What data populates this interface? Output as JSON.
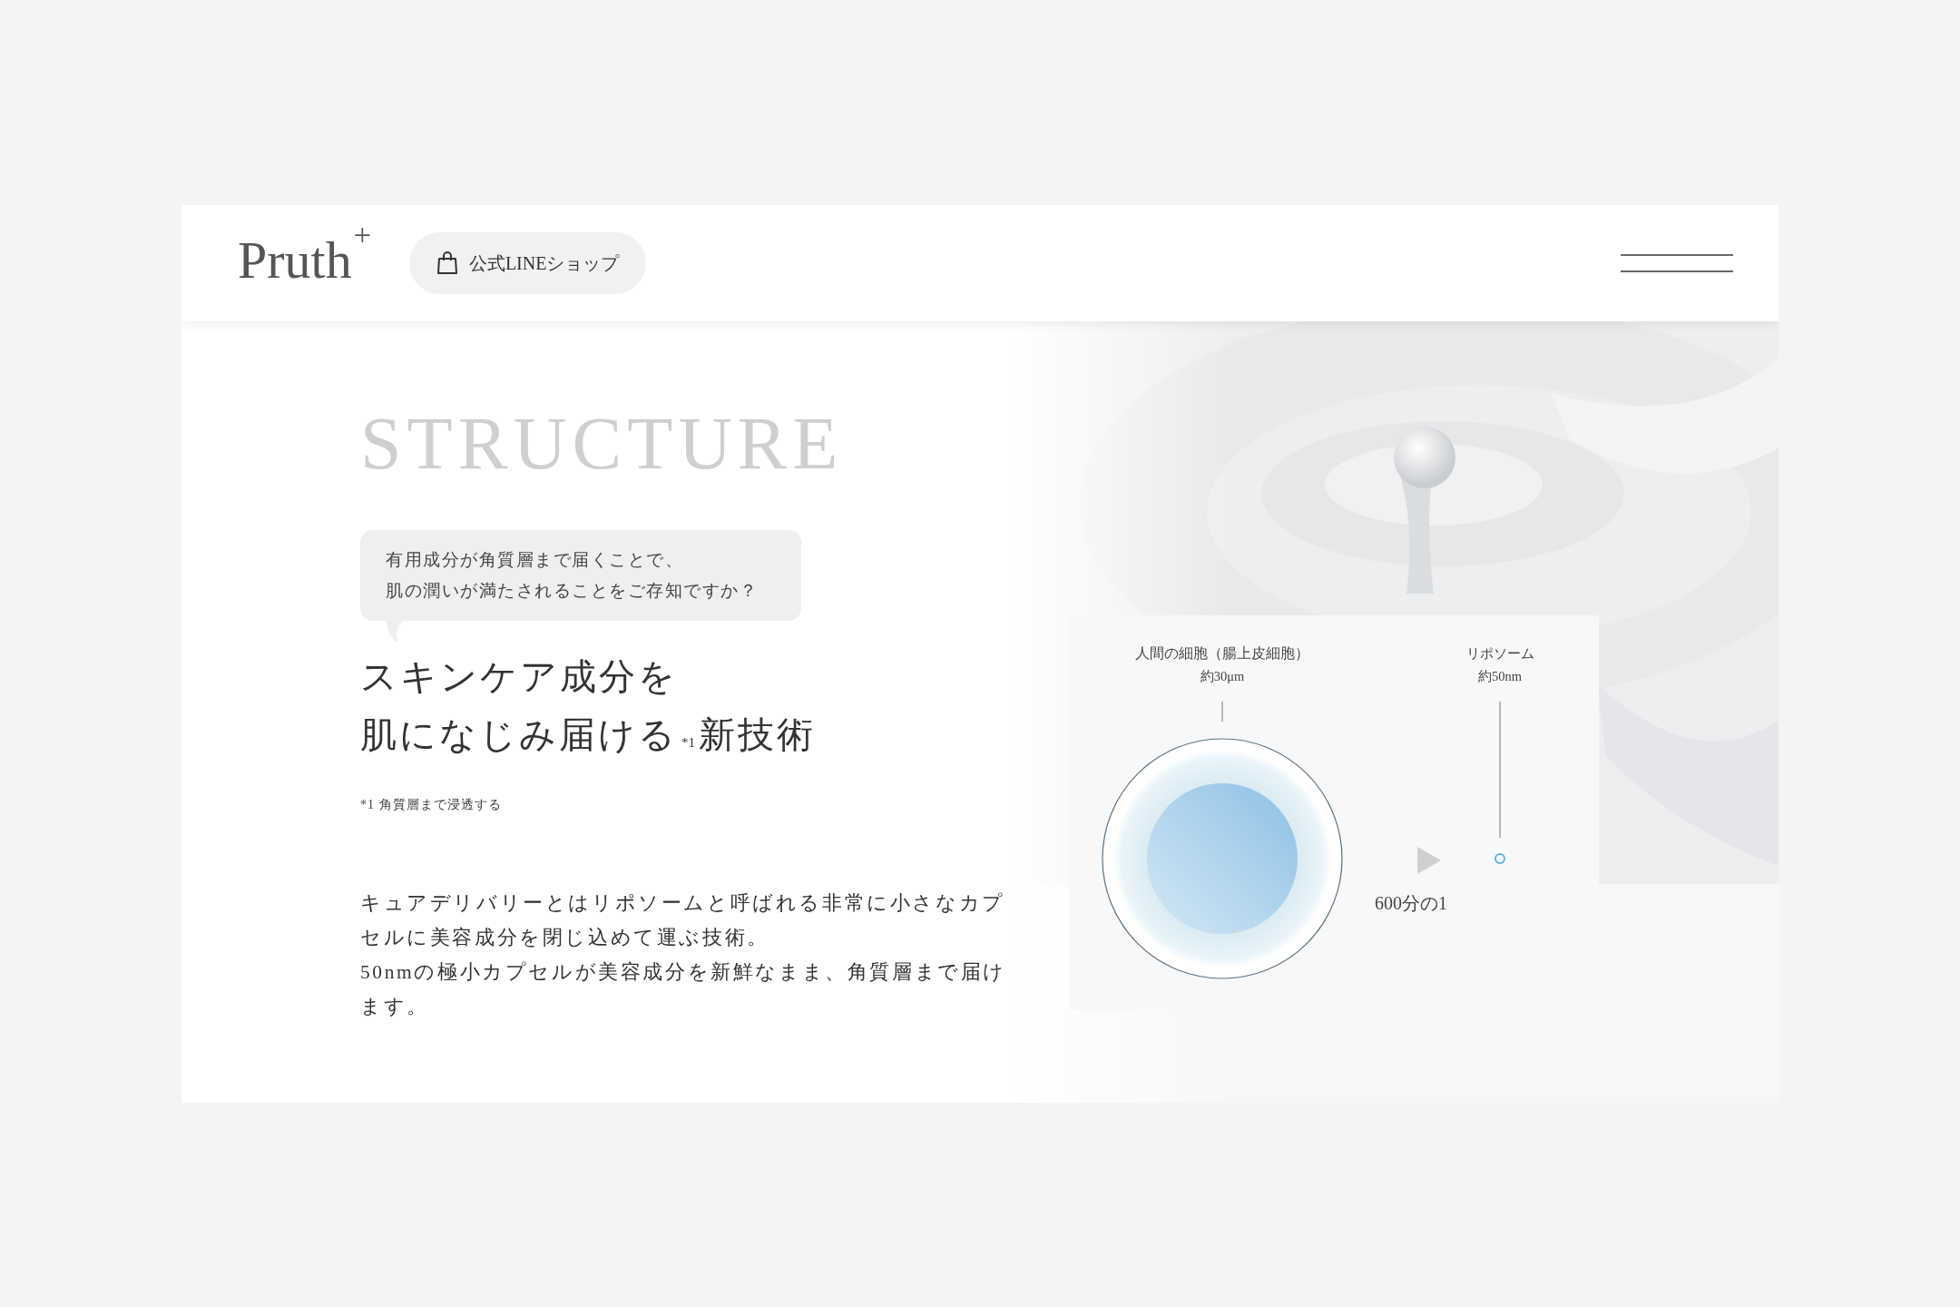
{
  "header": {
    "logo": "Pruth",
    "logo_mark": "+",
    "shop_button": "公式LINEショップ"
  },
  "section": {
    "title": "STRUCTURE",
    "bubble_lines": [
      "有用成分が角質層まで届くことで、",
      "肌の潤いが満たされることをご存知ですか？"
    ],
    "heading_lines": [
      "スキンケア成分を",
      "肌になじみ届ける$_{*1}$新技術"
    ],
    "footnote": "*1 角質層まで浸透する",
    "paragraphs": [
      "キュアデリバリーとはリポソームと呼ばれる非常に小さなカプセルに美容成分を閉じ込めて運ぶ技術。",
      "50nmの極小カプセルが美容成分を新鮮なまま、角質層まで届けます。"
    ]
  },
  "diagram": {
    "cell": {
      "label": "人間の細胞（腸上皮細胞）",
      "size": "約30μm"
    },
    "ratio": "600分の1",
    "liposome": {
      "label": "リポソーム",
      "size": "約50nm"
    }
  }
}
